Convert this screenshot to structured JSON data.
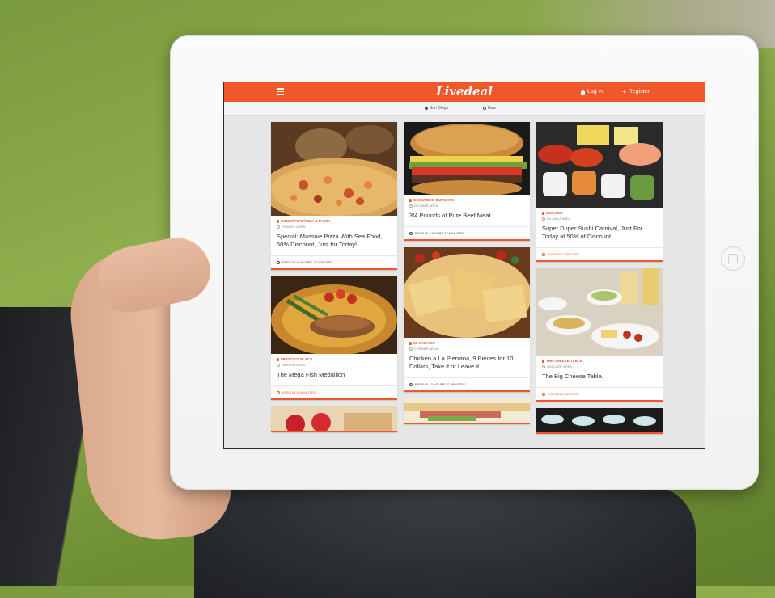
{
  "app": {
    "logo": "Livedeal",
    "login_label": "Log in",
    "register_label": "Register",
    "location": "San Diego",
    "time_filter": "Now"
  },
  "columns": [
    {
      "cards": [
        {
          "photo": "pizza",
          "vendor": "GIUSEPPE'S PIZZA & PASTA",
          "area": "ORANGE AREA",
          "title": "Special: Massive Pizza With Sea Food, 50% Discount, Just for Today!",
          "ends": "ENDS IN 10 HOURS 27 MINUTES"
        },
        {
          "photo": "fish",
          "vendor": "FRESCO'S PLACE",
          "area": "HARBOR AREA",
          "title": "The Mega Fish Medallion",
          "ends": "ENDS IN 29 MINUTES"
        },
        {
          "photo": "strawberry"
        }
      ]
    },
    {
      "cards": [
        {
          "photo": "burger",
          "vendor": "GROUNDED BURGERS",
          "area": "DEL MAR AREA",
          "title": "3/4 Pounds of Pure Beef Meat.",
          "ends": "ENDS IN 3 HOURS 27 MINUTES"
        },
        {
          "photo": "lasagna",
          "vendor": "EL PALACIO",
          "area": "CORNER AREA",
          "title": "Chicken a La Pierrana, 9 Pieces for 10 Dollars, Take it or Leave it.",
          "ends": "ENDS IN 13 HOURS 57 MINUTES"
        },
        {
          "photo": "sandwich"
        }
      ]
    },
    {
      "cards": [
        {
          "photo": "sushi",
          "vendor": "SUSHIRO",
          "area": "LA JOLLA AREA",
          "title": "Super Duper Sushi Carnival, Just For Today at 50% of Discount.",
          "ends": "ENDS IN 2 MINUTES"
        },
        {
          "photo": "cheese",
          "vendor": "THE CHEESE TABLE",
          "area": "GASLAMP AREA",
          "title": "The Big Cheese Table.",
          "ends": "ENDS IN 2 MINUTES"
        },
        {
          "photo": "plates"
        }
      ]
    }
  ],
  "colors": {
    "accent": "#f0582c",
    "bezel": "#f5f5f5",
    "screen_bg": "#e6e6e6"
  },
  "icons": [
    "menu-icon",
    "user-icon",
    "plus-icon",
    "pin-icon",
    "clock-icon"
  ]
}
